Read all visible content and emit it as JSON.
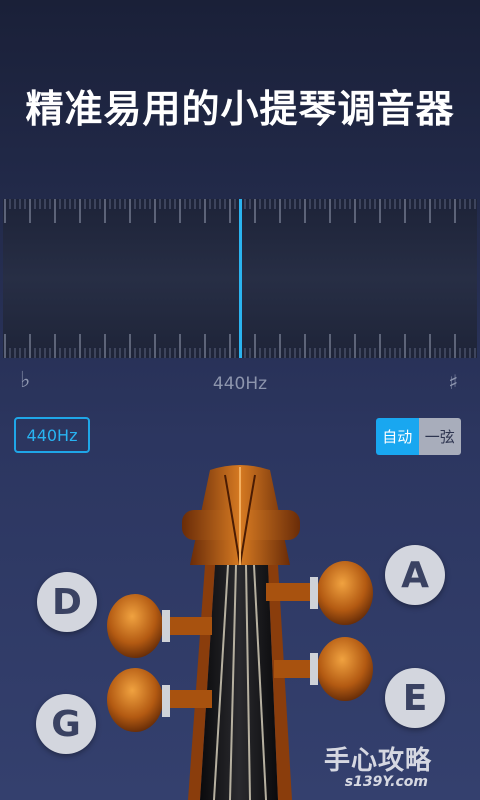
{
  "headline": "精准易用的小提琴调音器",
  "tuner": {
    "flat_symbol": "♭",
    "sharp_symbol": "♯",
    "frequency_display": "440Hz"
  },
  "reference_pitch": {
    "label": "440Hz"
  },
  "mode": {
    "auto_label": "自动",
    "single_string_label": "一弦",
    "selected": "auto"
  },
  "strings": {
    "d": "D",
    "g": "G",
    "a": "A",
    "e": "E"
  },
  "watermark": {
    "title": "手心攻略",
    "domain": "s139Y.com"
  },
  "colors": {
    "accent": "#1fa6e8",
    "needle": "#2bb4f0"
  }
}
